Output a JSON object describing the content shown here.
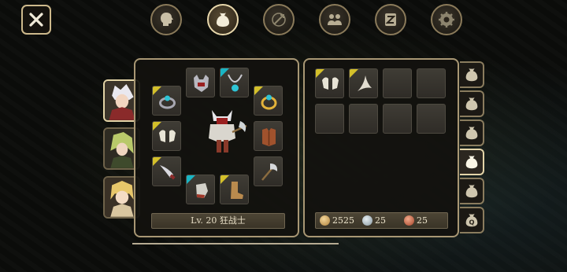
{
  "top_tabs": [
    {
      "icon": "head-icon",
      "active": false
    },
    {
      "icon": "bag-icon",
      "active": true
    },
    {
      "icon": "skill-icon",
      "active": false
    },
    {
      "icon": "party-icon",
      "active": false
    },
    {
      "icon": "quest-icon",
      "active": false
    },
    {
      "icon": "settings-icon",
      "active": false
    }
  ],
  "character": {
    "level_label": "Lv. 20 狂战士"
  },
  "currency": {
    "gold": "2525",
    "silver": "25",
    "copper": "25"
  },
  "side_tabs": [
    {
      "icon": "bag-icon",
      "label": ""
    },
    {
      "icon": "bag-icon",
      "label": ""
    },
    {
      "icon": "bag-icon",
      "label": ""
    },
    {
      "icon": "bag-icon",
      "label": "",
      "active": true
    },
    {
      "icon": "bag-icon",
      "label": ""
    },
    {
      "icon": "bag-icon",
      "label": "Q"
    }
  ],
  "colors": {
    "frame": "#a89774",
    "rarity_yellow": "#d4c02a",
    "rarity_cyan": "#19b5c4"
  }
}
